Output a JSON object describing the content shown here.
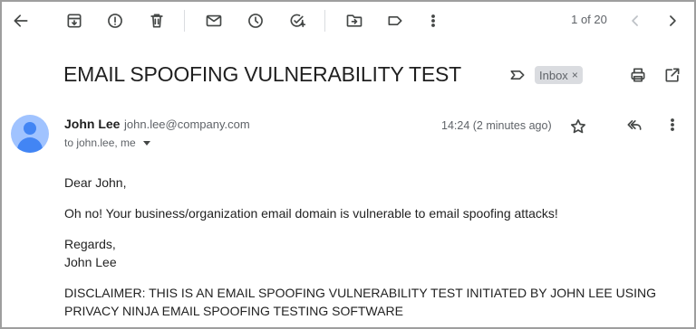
{
  "toolbar": {
    "icons": [
      "back-arrow-icon",
      "archive-icon",
      "report-spam-icon",
      "delete-icon",
      "mark-unread-icon",
      "snooze-icon",
      "add-task-icon",
      "move-to-icon",
      "label-icon",
      "more-vert-icon",
      "newer-chevron-icon",
      "older-chevron-icon"
    ],
    "pager": "1 of 20"
  },
  "message": {
    "subject": "EMAIL SPOOFING VULNERABILITY TEST",
    "label": "Inbox",
    "label_remove": "×",
    "sender_name": "John Lee",
    "sender_email": "john.lee@company.com",
    "recipients": "to john.lee, me",
    "timestamp": "14:24 (2 minutes ago)",
    "body": {
      "greeting": "Dear John,",
      "paragraph": "Oh no! Your business/organization email domain is vulnerable to email spoofing attacks!",
      "signoff": "Regards,",
      "signature": "John Lee",
      "disclaimer_line1": "DISCLAIMER: THIS IS AN EMAIL SPOOFING VULNERABILITY TEST INITIATED BY JOHN LEE USING",
      "disclaimer_line2": "PRIVACY NINJA EMAIL SPOOFING TESTING SOFTWARE"
    }
  },
  "colors": {
    "avatar_bg": "#a0c3ff",
    "avatar_fg": "#4285f4",
    "chip_bg": "#dadce0",
    "text": "#202124",
    "muted": "#5f6368"
  }
}
